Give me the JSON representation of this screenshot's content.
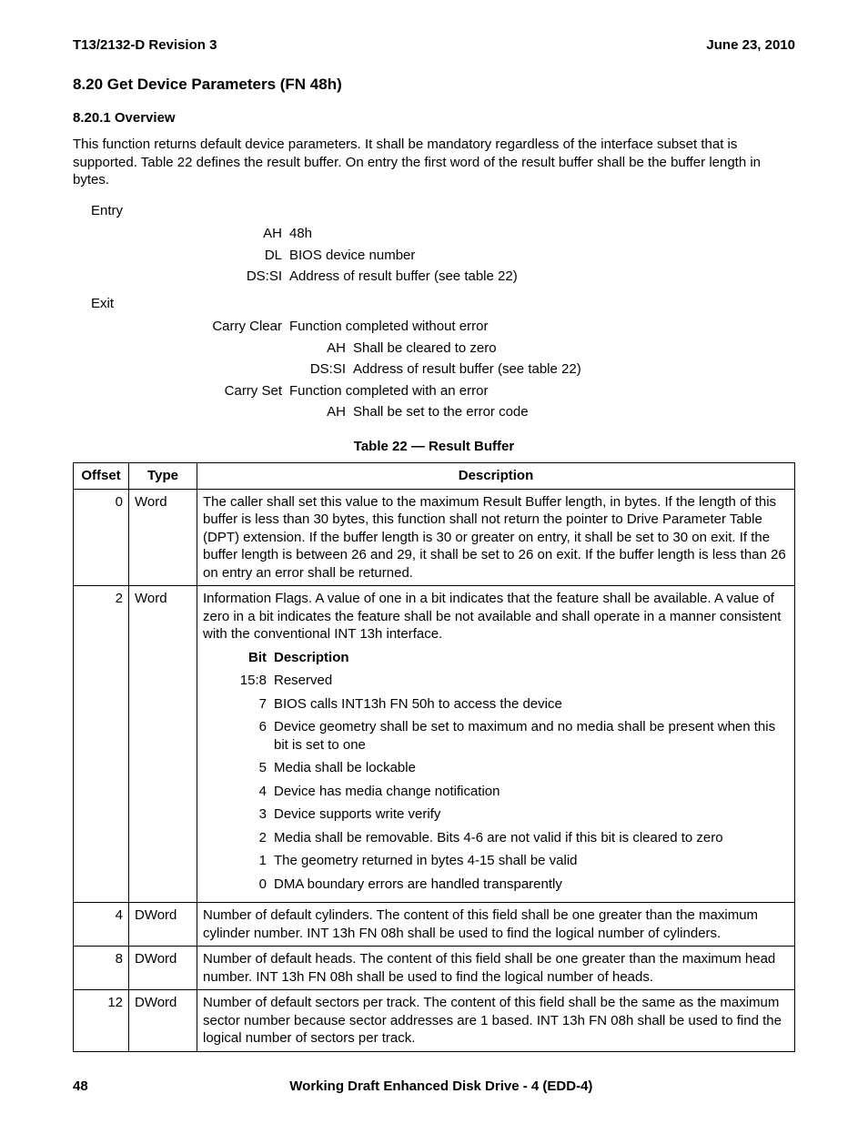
{
  "header": {
    "left": "T13/2132-D Revision 3",
    "right": "June 23, 2010"
  },
  "title": "8.20 Get Device Parameters (FN 48h)",
  "subtitle": "8.20.1 Overview",
  "overview": "This function returns default device parameters.  It shall be mandatory regardless of the interface subset that is supported.  Table 22 defines the result buffer.  On entry the first word of the result buffer shall be the buffer length in bytes.",
  "entry_label": "Entry",
  "entry": [
    {
      "reg": "AH",
      "desc": "48h"
    },
    {
      "reg": "DL",
      "desc": "BIOS device number"
    },
    {
      "reg": "DS:SI",
      "desc": "Address of result buffer (see table 22)"
    }
  ],
  "exit_label": "Exit",
  "carry_clear_label": "Carry Clear",
  "carry_clear_desc": "Function completed without error",
  "carry_clear_sub": [
    {
      "reg": "AH",
      "desc": "Shall be cleared to zero"
    },
    {
      "reg": "DS:SI",
      "desc": "Address of result buffer (see table 22)"
    }
  ],
  "carry_set_label": "Carry Set",
  "carry_set_desc": "Function completed with an error",
  "carry_set_sub": [
    {
      "reg": "AH",
      "desc": "Shall be set to the error code"
    }
  ],
  "table_caption": "Table 22 — Result Buffer",
  "th": {
    "offset": "Offset",
    "type": "Type",
    "desc": "Description"
  },
  "bit_header": {
    "bit": "Bit",
    "desc": "Description"
  },
  "rows": [
    {
      "offset": "0",
      "type": "Word",
      "desc": "The caller shall set this value to the maximum Result Buffer length, in bytes.  If the length of this buffer is less than 30 bytes, this function shall not return the pointer to Drive Parameter Table (DPT) extension.  If the buffer length is 30 or greater on entry, it shall be set to 30 on exit.  If the buffer length is between 26 and 29, it shall be set to 26 on exit.  If the buffer length is less than 26 on entry an error shall be returned."
    },
    {
      "offset": "2",
      "type": "Word",
      "desc": "Information Flags.  A value of one in a bit indicates that the feature shall be available.  A value of zero in a bit indicates the feature shall be not available and shall operate in a manner consistent with the conventional INT 13h interface.",
      "bits": [
        {
          "bit": "15:8",
          "desc": "Reserved"
        },
        {
          "bit": "7",
          "desc": "BIOS calls INT13h FN 50h to access the device"
        },
        {
          "bit": "6",
          "desc": "Device geometry shall be set to maximum and no media shall be present when this bit is set to one"
        },
        {
          "bit": "5",
          "desc": "Media shall be lockable"
        },
        {
          "bit": "4",
          "desc": "Device has media change notification"
        },
        {
          "bit": "3",
          "desc": "Device supports write verify"
        },
        {
          "bit": "2",
          "desc": "Media shall be removable.  Bits 4-6 are not valid if this bit is cleared to zero"
        },
        {
          "bit": "1",
          "desc": "The geometry returned in bytes 4-15 shall be valid"
        },
        {
          "bit": "0",
          "desc": "DMA boundary errors are handled transparently"
        }
      ]
    },
    {
      "offset": "4",
      "type": "DWord",
      "desc": "Number of default cylinders.  The content of this field shall be  one greater than the maximum cylinder number.  INT 13h FN 08h shall be used to find the logical number of cylinders."
    },
    {
      "offset": "8",
      "type": "DWord",
      "desc": "Number of default heads.  The content of this field shall be  one greater than the maximum head number.  INT 13h FN 08h shall be used to find the logical number of heads."
    },
    {
      "offset": "12",
      "type": "DWord",
      "desc": "Number of default sectors per track.  The content of this field shall be the same as the maximum sector number because sector addresses are 1 based.  INT 13h FN 08h shall be used to find the logical number of sectors per track."
    }
  ],
  "footer": {
    "page": "48",
    "title": "Working Draft Enhanced Disk Drive - 4  (EDD-4)"
  }
}
